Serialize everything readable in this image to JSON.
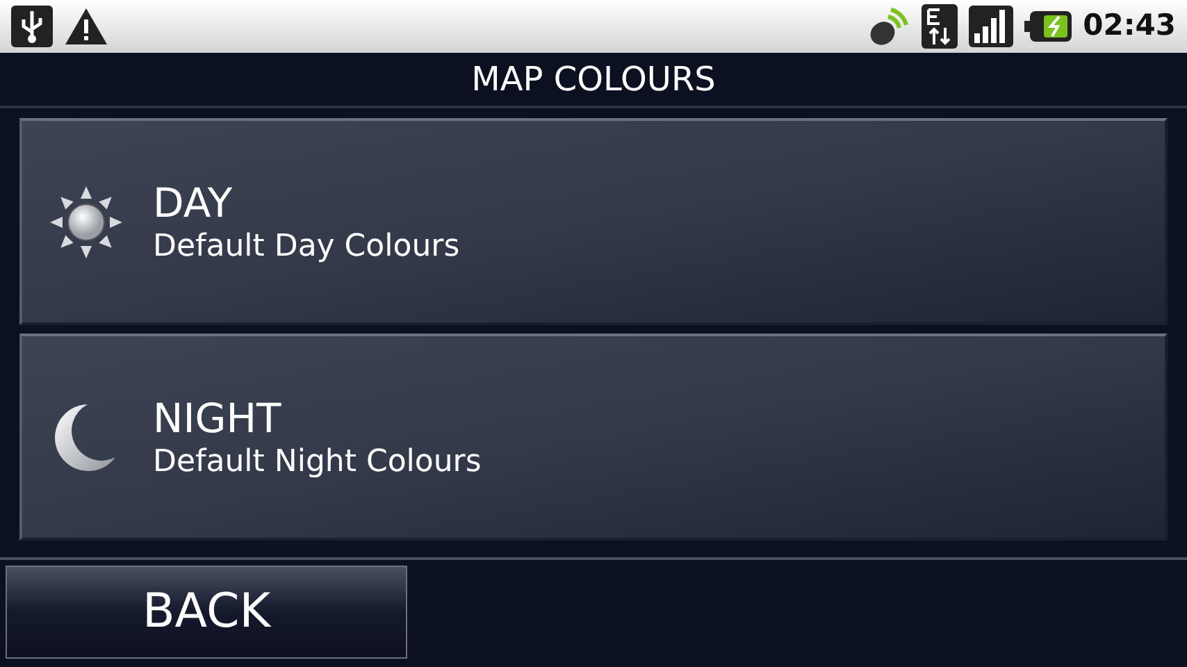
{
  "status_bar": {
    "time": "02:43"
  },
  "title": "MAP COLOURS",
  "options": [
    {
      "kind": "day",
      "label": "DAY",
      "description": "Default Day Colours"
    },
    {
      "kind": "night",
      "label": "NIGHT",
      "description": "Default Night Colours"
    }
  ],
  "back_button": "BACK"
}
